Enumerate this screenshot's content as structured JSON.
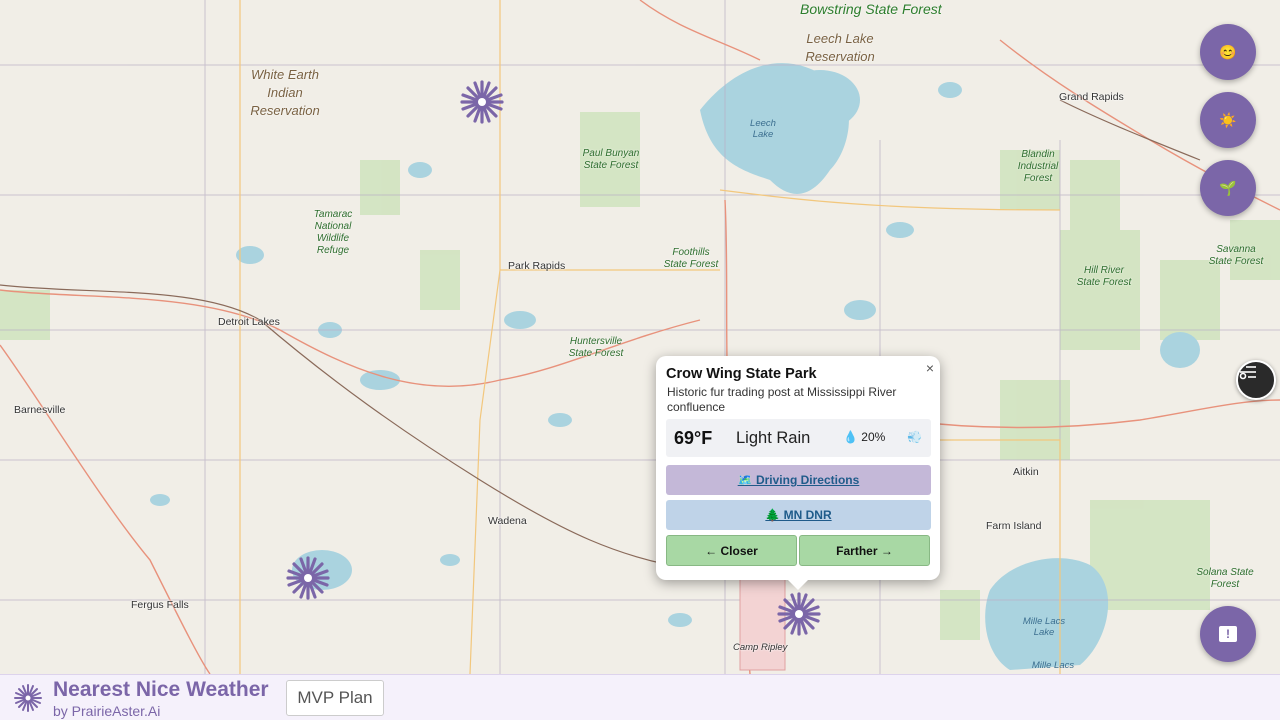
{
  "map": {
    "places": {
      "grand_rapids": "Grand Rapids",
      "park_rapids": "Park Rapids",
      "detroit_lakes": "Detroit Lakes",
      "barnesville": "Barnesville",
      "wadena": "Wadena",
      "fergus_falls": "Fergus Falls",
      "aitkin": "Aitkin",
      "farm_island": "Farm Island",
      "camp_ripley": "Camp Ripley"
    },
    "reservations": {
      "white_earth": "White Earth Indian Reservation",
      "leech_lake": "Leech Lake Reservation"
    },
    "forests": {
      "bowstring": "Bowstring State Forest",
      "paul_bunyan": "Paul Bunyan State Forest",
      "tamarac": "Tamarac National Wildlife Refuge",
      "foothills": "Foothills State Forest",
      "huntersville": "Huntersville State Forest",
      "blandin": "Blandin Industrial Forest",
      "hill_river": "Hill River State Forest",
      "savanna": "Savanna State Forest",
      "solana": "Solana State Forest"
    },
    "lakes": {
      "leech": "Leech Lake",
      "mille_lacs": "Mille Lacs Lake",
      "mille_lacs_2": "Mille Lacs"
    }
  },
  "fab": {
    "mood_icon": "😊",
    "sun_icon": "☀️",
    "plant_icon": "🌱",
    "feedback_icon": "!"
  },
  "popup": {
    "title": "Crow Wing State Park",
    "description": "Historic fur trading post at Mississippi River confluence",
    "close": "×",
    "temperature": "69°F",
    "condition": "Light Rain",
    "precip": "💧 20%",
    "wind": "💨",
    "directions_label": "🗺️ Driving Directions",
    "dnr_label": "🌲 MN DNR",
    "closer_label": "← Closer",
    "farther_label": "Farther →",
    "colors": {
      "directions_bg": "#c4b8d8",
      "dnr_bg": "#bfd3e8",
      "nav_bg": "#a8d8a4"
    }
  },
  "footer": {
    "brand": "Nearest Nice Weather",
    "byline": "by PrairieAster.Ai",
    "plan_button": "MVP Plan"
  },
  "colors": {
    "accent": "#7b66a8"
  }
}
